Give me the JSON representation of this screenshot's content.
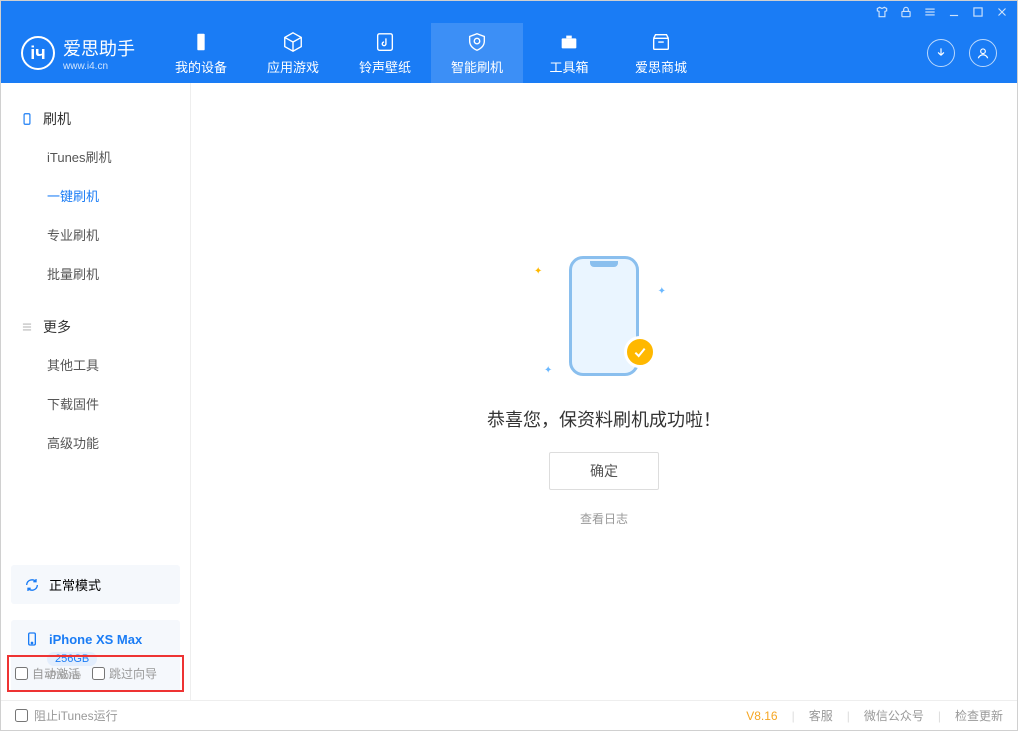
{
  "app": {
    "name": "爱思助手",
    "url": "www.i4.cn"
  },
  "nav": {
    "tabs": [
      {
        "label": "我的设备"
      },
      {
        "label": "应用游戏"
      },
      {
        "label": "铃声壁纸"
      },
      {
        "label": "智能刷机"
      },
      {
        "label": "工具箱"
      },
      {
        "label": "爱思商城"
      }
    ]
  },
  "sidebar": {
    "section_flash": "刷机",
    "items_flash": [
      {
        "label": "iTunes刷机"
      },
      {
        "label": "一键刷机"
      },
      {
        "label": "专业刷机"
      },
      {
        "label": "批量刷机"
      }
    ],
    "section_more": "更多",
    "items_more": [
      {
        "label": "其他工具"
      },
      {
        "label": "下载固件"
      },
      {
        "label": "高级功能"
      }
    ],
    "mode": "正常模式",
    "device": {
      "name": "iPhone XS Max",
      "capacity": "256GB",
      "type": "iPhone"
    },
    "auto_activate": "自动激活",
    "skip_guide": "跳过向导"
  },
  "main": {
    "message": "恭喜您，保资料刷机成功啦！",
    "confirm": "确定",
    "view_log": "查看日志"
  },
  "statusbar": {
    "block_itunes": "阻止iTunes运行",
    "version": "V8.16",
    "support": "客服",
    "wechat": "微信公众号",
    "update": "检查更新"
  }
}
